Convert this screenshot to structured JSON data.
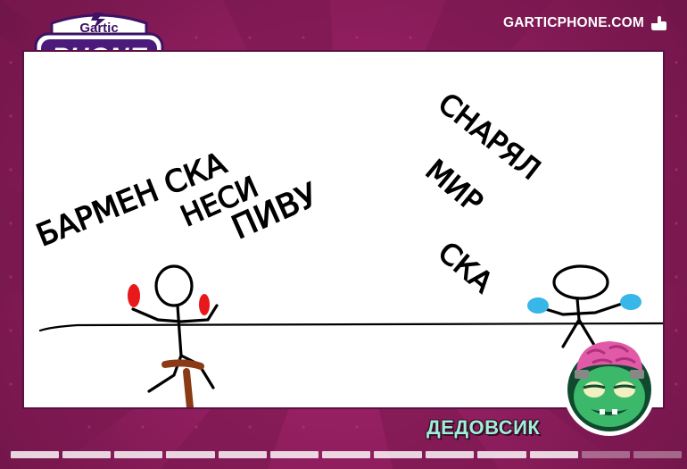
{
  "game": {
    "logo_top": "Gartic",
    "logo_bottom": "PHONE",
    "site_label": "GARTICPHONE.COM",
    "site_icon": "pointing-hand-icon"
  },
  "drawing": {
    "description_left": [
      "БАРМЕН СКА",
      "НЕСИ",
      "ПИВУ"
    ],
    "description_right": [
      "СНАРЯЛ",
      "МИР",
      "СКА"
    ],
    "ink_color": "#000000",
    "left_hands_color": "#e8191a",
    "right_hands_color": "#38b6e8",
    "stool_color": "#8a3a14"
  },
  "player": {
    "name": "ДЕДОВСИК",
    "avatar_icon": "zombie-brain-avatar-icon"
  },
  "progress": {
    "total_steps": 13,
    "completed_steps": 11
  },
  "colors": {
    "background": "#8e1f5f",
    "name_text": "#9ff0d5",
    "logo_purple": "#3d1264"
  }
}
